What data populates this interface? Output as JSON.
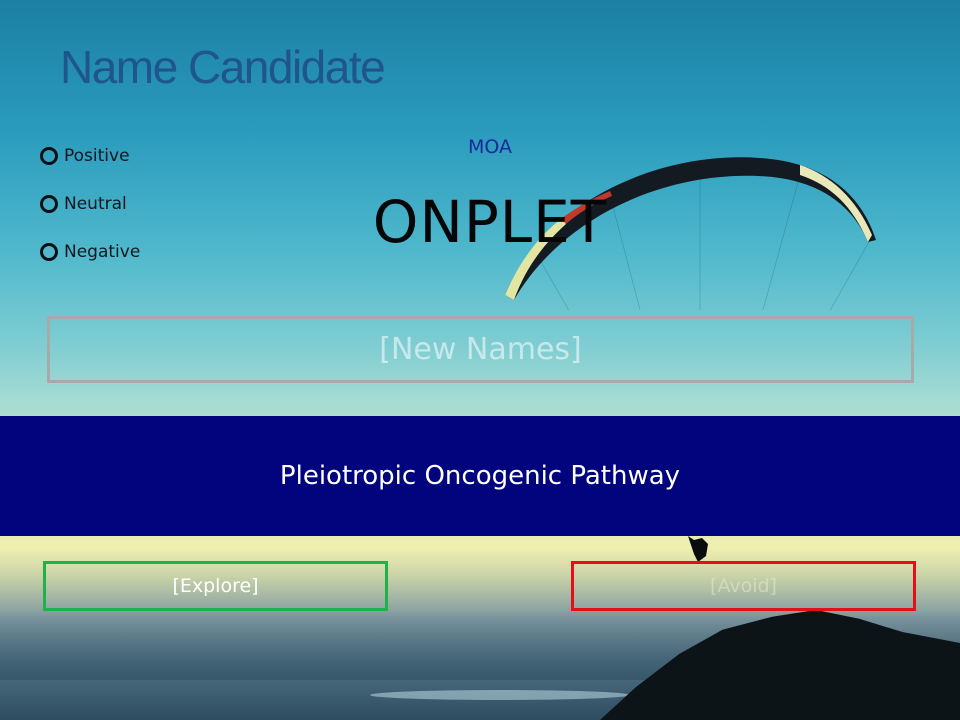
{
  "slide": {
    "title": "Name Candidate",
    "moa_label": "MOA",
    "candidate_name": "ONPLET",
    "new_names_placeholder": "[New Names]",
    "banner_text": "Pleiotropic Oncogenic Pathway",
    "explore_label": "[Explore]",
    "avoid_label": "[Avoid]"
  },
  "rating": {
    "options": [
      "Positive",
      "Neutral",
      "Negative"
    ]
  },
  "colors": {
    "title": "#1f4c86",
    "moa": "#1a2a9a",
    "banner_bg": "#02047d",
    "new_names_border": "#a9a9a9",
    "explore_border": "#21b14a",
    "avoid_border": "#e3101a"
  },
  "icons": {
    "radio": "radio-circle-icon",
    "background": "paraglider-photo"
  }
}
